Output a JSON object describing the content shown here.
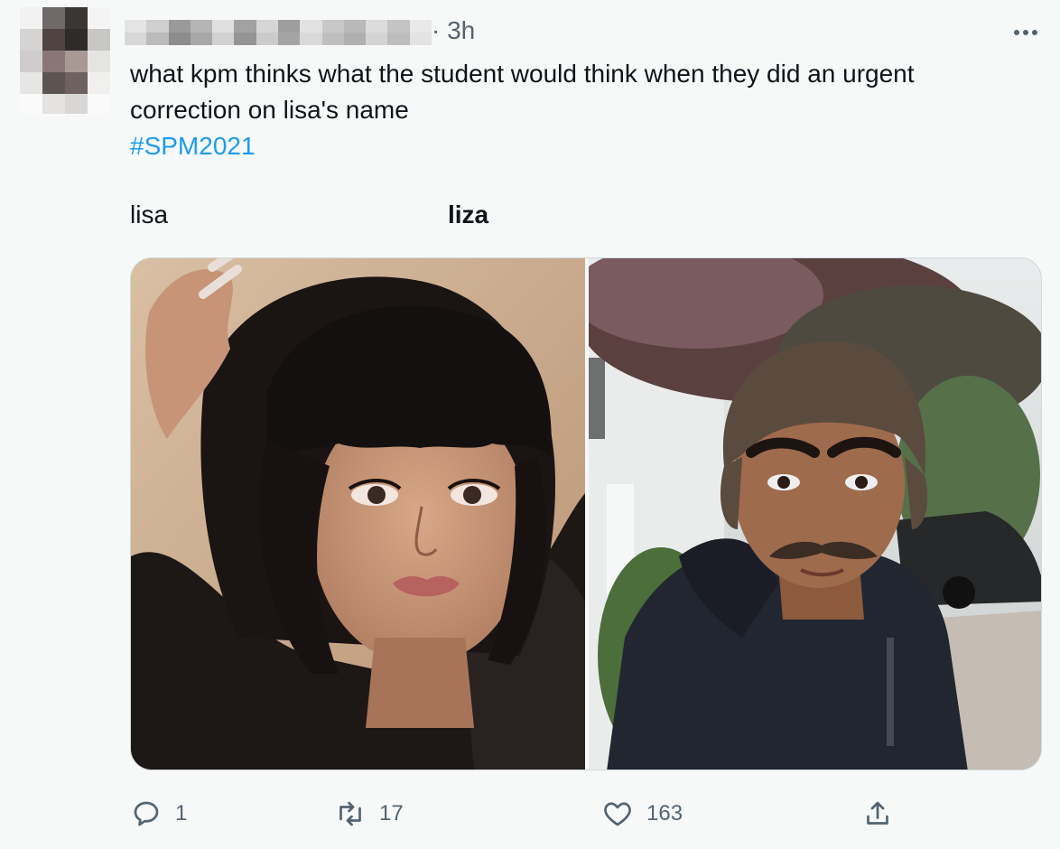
{
  "tweet": {
    "timestamp": "· 3h",
    "text_line1": "what kpm thinks what the student would think when they did an urgent",
    "text_line2": "correction on lisa's name",
    "hashtag": "#SPM2021",
    "label_left": "lisa",
    "label_right": "liza"
  },
  "actions": {
    "reply_count": "1",
    "retweet_count": "17",
    "like_count": "163"
  },
  "icons": {
    "more": "more-horizontal-icon",
    "reply": "reply-icon",
    "retweet": "retweet-icon",
    "like": "heart-icon",
    "share": "share-icon"
  },
  "colors": {
    "link": "#1d9bf0",
    "muted": "#536471",
    "text": "#0f1419",
    "background": "#f7f9f9"
  }
}
